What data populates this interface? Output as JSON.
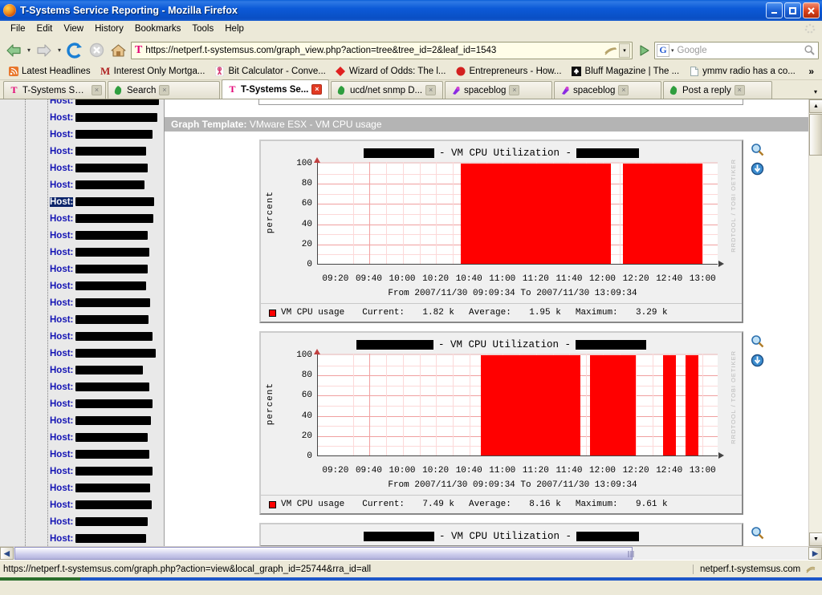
{
  "window": {
    "title": "T-Systems Service Reporting - Mozilla Firefox",
    "minimize_label": "Minimize",
    "restore_label": "Restore",
    "close_label": "Close"
  },
  "menu": {
    "items": [
      {
        "label": "File",
        "accel": "F"
      },
      {
        "label": "Edit",
        "accel": "E"
      },
      {
        "label": "View",
        "accel": "V"
      },
      {
        "label": "History",
        "accel": "s"
      },
      {
        "label": "Bookmarks",
        "accel": "B"
      },
      {
        "label": "Tools",
        "accel": "T"
      },
      {
        "label": "Help",
        "accel": "H"
      }
    ]
  },
  "toolbar": {
    "back_label": "Back",
    "forward_label": "Forward",
    "reload_label": "Reload",
    "stop_label": "Stop",
    "home_label": "Home",
    "url": "https://netperf.t-systemsus.com/graph_view.php?action=tree&tree_id=2&leaf_id=1543",
    "site_logo": "T",
    "go_label": "Go",
    "search_engine": "G",
    "search_placeholder": "Google",
    "search_value": ""
  },
  "bookmarks": {
    "items": [
      {
        "label": "Latest Headlines",
        "icon": "rss-icon"
      },
      {
        "label": "Interest Only Mortga...",
        "icon": "m-letter-icon"
      },
      {
        "label": "Bit Calculator - Conve...",
        "icon": "bookmark-icon"
      },
      {
        "label": "Wizard of Odds: The l...",
        "icon": "diamond-icon"
      },
      {
        "label": "Entrepreneurs - How...",
        "icon": "circle-icon"
      },
      {
        "label": "Bluff Magazine | The ...",
        "icon": "spade-icon"
      },
      {
        "label": "ymmv radio has a co...",
        "icon": "page-icon"
      }
    ],
    "overflow": "»"
  },
  "tabs": {
    "items": [
      {
        "label": "T-Systems Servi...",
        "favicon": "t-logo-icon",
        "active": false
      },
      {
        "label": "Search",
        "favicon": "firefox-icon",
        "active": false
      },
      {
        "label": "T-Systems Se...",
        "favicon": "t-logo-icon",
        "active": true
      },
      {
        "label": "ucd/net snmp D...",
        "favicon": "firefox-icon",
        "active": false
      },
      {
        "label": "spaceblog",
        "favicon": "blog-icon",
        "active": false
      },
      {
        "label": "spaceblog",
        "favicon": "blog-icon",
        "active": false
      },
      {
        "label": "Post a reply",
        "favicon": "firefox-icon",
        "active": false
      }
    ],
    "close_glyph": "×",
    "list_glyph": "▾"
  },
  "sidebar": {
    "host_label": "Host:",
    "rows": [
      {
        "redacted": true,
        "width": 104,
        "selected": false,
        "partial": true
      },
      {
        "redacted": true,
        "width": 102,
        "selected": false
      },
      {
        "redacted": true,
        "width": 96,
        "selected": false
      },
      {
        "redacted": true,
        "width": 88,
        "selected": false
      },
      {
        "redacted": true,
        "width": 90,
        "selected": false
      },
      {
        "redacted": true,
        "width": 86,
        "selected": false
      },
      {
        "redacted": true,
        "width": 98,
        "selected": true
      },
      {
        "redacted": true,
        "width": 97,
        "selected": false
      },
      {
        "redacted": true,
        "width": 90,
        "selected": false
      },
      {
        "redacted": true,
        "width": 92,
        "selected": false
      },
      {
        "redacted": true,
        "width": 90,
        "selected": false
      },
      {
        "redacted": true,
        "width": 88,
        "selected": false
      },
      {
        "redacted": true,
        "width": 93,
        "selected": false
      },
      {
        "redacted": true,
        "width": 91,
        "selected": false
      },
      {
        "redacted": true,
        "width": 96,
        "selected": false
      },
      {
        "redacted": true,
        "width": 100,
        "selected": false
      },
      {
        "redacted": true,
        "width": 84,
        "selected": false
      },
      {
        "redacted": true,
        "width": 92,
        "selected": false
      },
      {
        "redacted": true,
        "width": 96,
        "selected": false
      },
      {
        "redacted": true,
        "width": 94,
        "selected": false
      },
      {
        "redacted": true,
        "width": 90,
        "selected": false
      },
      {
        "redacted": true,
        "width": 92,
        "selected": false
      },
      {
        "redacted": true,
        "width": 96,
        "selected": false
      },
      {
        "redacted": true,
        "width": 93,
        "selected": false
      },
      {
        "redacted": true,
        "width": 95,
        "selected": false
      },
      {
        "redacted": true,
        "width": 90,
        "selected": false
      },
      {
        "redacted": true,
        "width": 88,
        "selected": false
      }
    ]
  },
  "main": {
    "template_label": "Graph Template:",
    "template_value": "VMware ESX - VM CPU usage",
    "zoom_icon_title": "Zoom Graph",
    "download_icon_title": "CSV Export",
    "watermark": "RRDTOOL / TOBI OETIKER"
  },
  "chart_data": [
    {
      "type": "area",
      "title_prefix": "",
      "title_middle": "VM CPU Utilization",
      "title_suffix": "",
      "title_prefix_redacted": true,
      "title_suffix_redacted": true,
      "ylabel": "percent",
      "ylim": [
        0,
        100
      ],
      "yticks": [
        0,
        20,
        40,
        60,
        80,
        100
      ],
      "xlabel": "",
      "xticks": [
        "09:20",
        "09:40",
        "10:00",
        "10:20",
        "10:40",
        "11:00",
        "11:20",
        "11:40",
        "12:00",
        "12:20",
        "12:40",
        "13:00"
      ],
      "xrange": [
        "09:09:34",
        "13:09:34"
      ],
      "footer": "From 2007/11/30 09:09:34 To 2007/11/30 13:09:34",
      "grid": true,
      "series_name": "VM CPU usage",
      "color": "#ff0000",
      "stats": {
        "current_label": "Current:",
        "current": "1.82 k",
        "average_label": "Average:",
        "average": "1.95 k",
        "maximum_label": "Maximum:",
        "maximum": "3.29 k"
      },
      "filled_spans": [
        [
          10.58,
          12.08
        ],
        [
          12.2,
          13.0
        ]
      ]
    },
    {
      "type": "area",
      "title_prefix": "",
      "title_middle": "VM CPU Utilization",
      "title_suffix": "",
      "title_prefix_redacted": true,
      "title_suffix_redacted": true,
      "ylabel": "percent",
      "ylim": [
        0,
        100
      ],
      "yticks": [
        0,
        20,
        40,
        60,
        80,
        100
      ],
      "xlabel": "",
      "xticks": [
        "09:20",
        "09:40",
        "10:00",
        "10:20",
        "10:40",
        "11:00",
        "11:20",
        "11:40",
        "12:00",
        "12:20",
        "12:40",
        "13:00"
      ],
      "xrange": [
        "09:09:34",
        "13:09:34"
      ],
      "footer": "From 2007/11/30 09:09:34 To 2007/11/30 13:09:34",
      "grid": true,
      "series_name": "VM CPU usage",
      "color": "#ff0000",
      "stats": {
        "current_label": "Current:",
        "current": "7.49 k",
        "average_label": "Average:",
        "average": "8.16 k",
        "maximum_label": "Maximum:",
        "maximum": "9.61 k"
      },
      "filled_spans": [
        [
          10.78,
          11.78
        ],
        [
          11.87,
          12.33
        ],
        [
          12.6,
          12.73
        ],
        [
          12.83,
          12.96
        ]
      ]
    },
    {
      "type": "area",
      "title_middle": "VM CPU Utilization",
      "title_prefix_redacted": true,
      "title_suffix_redacted": true,
      "partial": true
    }
  ],
  "statusbar": {
    "link_url": "https://netperf.t-systemsus.com/graph.php?action=view&local_graph_id=25744&rra_id=all",
    "security_host": "netperf.t-systemsus.com",
    "lock_icon": "lock-icon"
  },
  "scrollbars": {
    "up_glyph": "▲",
    "down_glyph": "▼",
    "left_glyph": "◀",
    "right_glyph": "▶"
  }
}
